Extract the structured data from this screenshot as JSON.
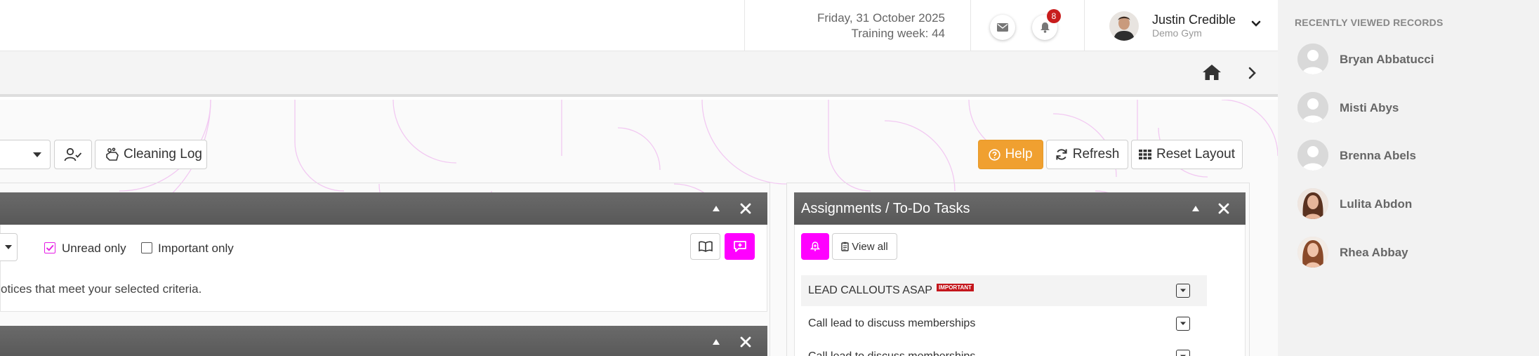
{
  "header": {
    "date": "Friday, 31 October 2025",
    "training_week": "Training week: 44",
    "notification_count": "8",
    "user": {
      "name": "Justin Credible",
      "gym": "Demo Gym"
    }
  },
  "toolbar": {
    "cleaning_log_label": "Cleaning Log",
    "help_label": "Help",
    "refresh_label": "Refresh",
    "reset_layout_label": "Reset Layout"
  },
  "notices": {
    "unread_only_label": "Unread only",
    "unread_only_checked": true,
    "important_only_label": "Important only",
    "important_only_checked": false,
    "empty_text": "otices that meet your selected criteria."
  },
  "assignments": {
    "title": "Assignments / To-Do Tasks",
    "view_all_label": "View all",
    "tasks": [
      {
        "label": "LEAD CALLOUTS ASAP",
        "badge": "IMPORTANT"
      },
      {
        "label": "Call lead to discuss memberships"
      },
      {
        "label": "Call lead to discuss memberships"
      }
    ]
  },
  "recent": {
    "title": "RECENTLY VIEWED RECORDS",
    "items": [
      {
        "name": "Bryan Abbatucci",
        "avatar": "placeholder"
      },
      {
        "name": "Misti Abys",
        "avatar": "placeholder"
      },
      {
        "name": "Brenna Abels",
        "avatar": "placeholder"
      },
      {
        "name": "Lulita Abdon",
        "avatar": "photo"
      },
      {
        "name": "Rhea Abbay",
        "avatar": "photo"
      }
    ]
  },
  "colors": {
    "accent_magenta": "#ff00ff",
    "help_orange": "#f0a030",
    "panel_header": "#606060",
    "badge_red": "#c81c1c"
  }
}
